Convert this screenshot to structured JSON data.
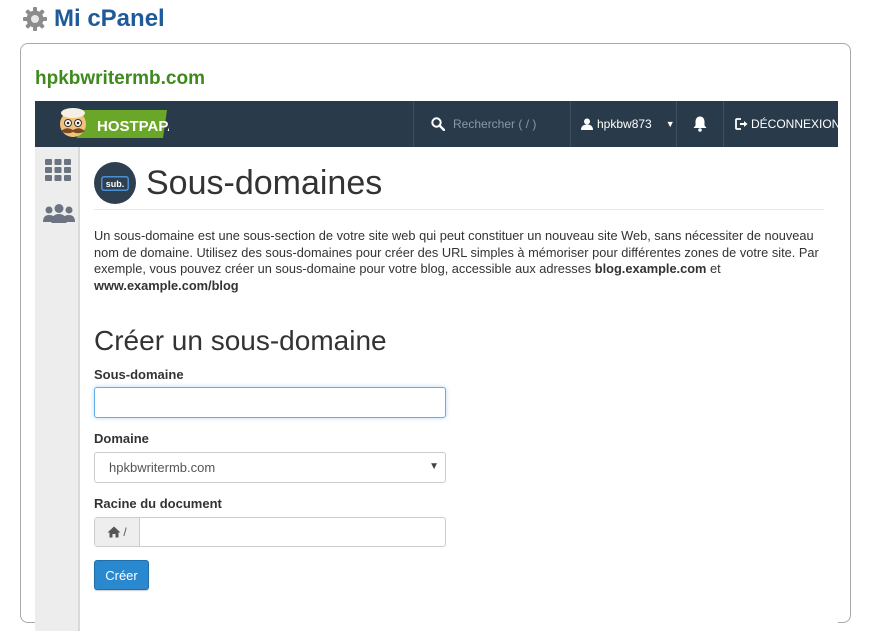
{
  "page": {
    "title": "Mi cPanel",
    "account_domain": "hpkbwritermb.com"
  },
  "navbar": {
    "logo_text": "HOSTPAPA",
    "search_placeholder": "Rechercher ( / )",
    "username": "hpkbw873",
    "logout_label": "DÉCONNEXION"
  },
  "sidebar": {
    "items": [
      {
        "icon": "grid-icon"
      },
      {
        "icon": "users-icon"
      }
    ]
  },
  "main": {
    "badge_text": "sub.",
    "page_title": "Sous-domaines",
    "description_part1": "Un sous-domaine est une sous-section de votre site web qui peut constituer un nouveau site Web, sans nécessiter de nouveau nom de domaine. Utilisez des sous-domaines pour créer des URL simples à mémoriser pour différentes zones de votre site. Par exemple, vous pouvez créer un sous-domaine pour votre blog, accessible aux adresses ",
    "description_bold1": "blog.example.com",
    "description_mid": " et ",
    "description_bold2": "www.example.com/blog",
    "section_title": "Créer un sous-domaine",
    "form": {
      "subdomain_label": "Sous-domaine",
      "subdomain_value": "",
      "domain_label": "Domaine",
      "domain_selected": "hpkbwritermb.com",
      "docroot_label": "Racine du document",
      "docroot_prefix": "/",
      "docroot_value": "",
      "submit_label": "Créer"
    }
  },
  "colors": {
    "title_blue": "#1f5b9b",
    "domain_green": "#3e8a1d",
    "navbar_bg": "#293a4a",
    "button_blue": "#2a88cf"
  }
}
